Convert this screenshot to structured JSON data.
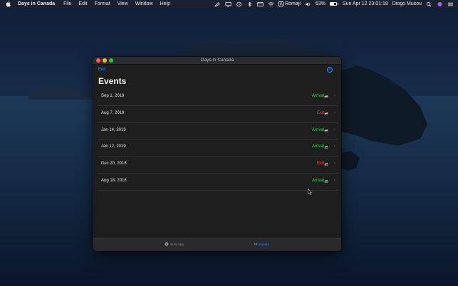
{
  "menubar": {
    "app_name": "Days in Canada",
    "menus": [
      "File",
      "Edit",
      "Format",
      "View",
      "Window",
      "Help"
    ],
    "status_icons": [
      "pen-icon",
      "display-icon",
      "time-machine-icon",
      "bluetooth-icon",
      "window-icon",
      "wifi-icon"
    ],
    "input_source": "Romaji",
    "volume_icon": "speaker-icon",
    "battery_percent": "63%",
    "battery_level": 0.63,
    "clock": "Sun Apr 12  23:01:18",
    "user": "Diogo Musou",
    "trailing_icons": [
      "search-icon",
      "siri-icon",
      "control-center-icon"
    ]
  },
  "window": {
    "title": "Days in Canada",
    "edit_label": "Edit",
    "add_symbol": "+",
    "heading": "Events",
    "events": [
      {
        "date": "Sep 1, 2019",
        "type": "Arrival",
        "kind": "arrival"
      },
      {
        "date": "Aug 7, 2019",
        "type": "Exit",
        "kind": "exit"
      },
      {
        "date": "Jan 14, 2019",
        "type": "Arrival",
        "kind": "arrival"
      },
      {
        "date": "Jan 12, 2019",
        "type": "Arrival",
        "kind": "arrival"
      },
      {
        "date": "Dec 20, 2018",
        "type": "Exit",
        "kind": "exit"
      },
      {
        "date": "Aug 18, 2018",
        "type": "Arrival",
        "kind": "arrival"
      }
    ],
    "chevron": "›",
    "tabs": {
      "summary": "Summary",
      "events": "Events"
    }
  },
  "colors": {
    "accent": "#2f8fff",
    "arrival": "#32d74b",
    "exit": "#ff453a"
  }
}
